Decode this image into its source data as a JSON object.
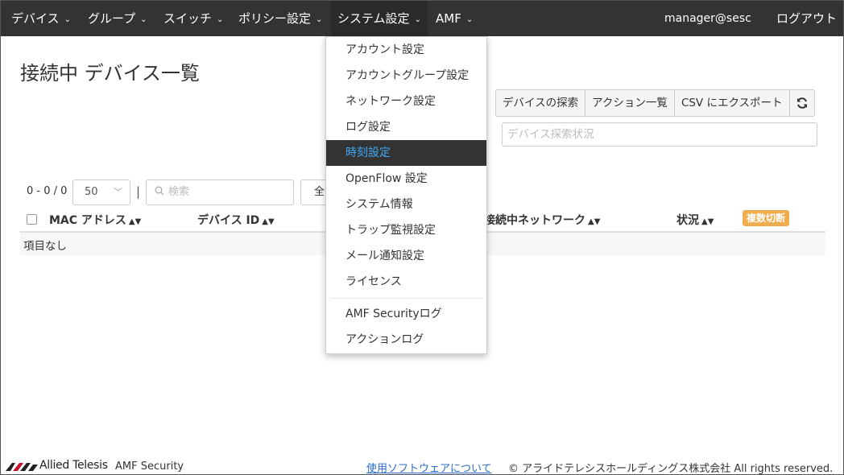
{
  "nav": {
    "items": [
      {
        "label": "デバイス"
      },
      {
        "label": "グループ"
      },
      {
        "label": "スイッチ"
      },
      {
        "label": "ポリシー設定"
      },
      {
        "label": "システム設定"
      },
      {
        "label": "AMF"
      }
    ],
    "user": "manager@sesc",
    "logout": "ログアウト"
  },
  "dropdown": {
    "items": [
      {
        "label": "アカウント設定"
      },
      {
        "label": "アカウントグループ設定"
      },
      {
        "label": "ネットワーク設定"
      },
      {
        "label": "ログ設定"
      },
      {
        "label": "時刻設定"
      },
      {
        "label": "OpenFlow 設定"
      },
      {
        "label": "システム情報"
      },
      {
        "label": "トラップ監視設定"
      },
      {
        "label": "メール通知設定"
      },
      {
        "label": "ライセンス"
      },
      {
        "label": "AMF Securityログ"
      },
      {
        "label": "アクションログ"
      }
    ],
    "active_index": 4
  },
  "page": {
    "title": "接続中 デバイス一覧"
  },
  "toolbar": {
    "discover": "デバイスの探索",
    "actions": "アクション一覧",
    "export_csv": "CSV にエクスポート",
    "refresh_icon": "refresh-icon"
  },
  "status_box": {
    "placeholder": "デバイス探索状況"
  },
  "list": {
    "count": "0 - 0 / 0",
    "per_page": "50",
    "search_placeholder": "検索",
    "filter_label": "全"
  },
  "table": {
    "columns": {
      "mac": "MAC アドレス",
      "device_id": "デバイス ID",
      "network": "接続中ネットワーク",
      "status": "状況"
    },
    "bulk_button": "複数切断",
    "empty": "項目なし"
  },
  "footer": {
    "brand": "Allied Telesis",
    "product": "AMF Security",
    "link": "使用ソフトウェアについて",
    "copyright": "© アライドテレシスホールディングス株式会社 All rights reserved."
  },
  "colors": {
    "navbar": "#333333",
    "active_item_text": "#3fa9f5",
    "badge": "#f0ad4e",
    "link": "#2a6ac8"
  }
}
